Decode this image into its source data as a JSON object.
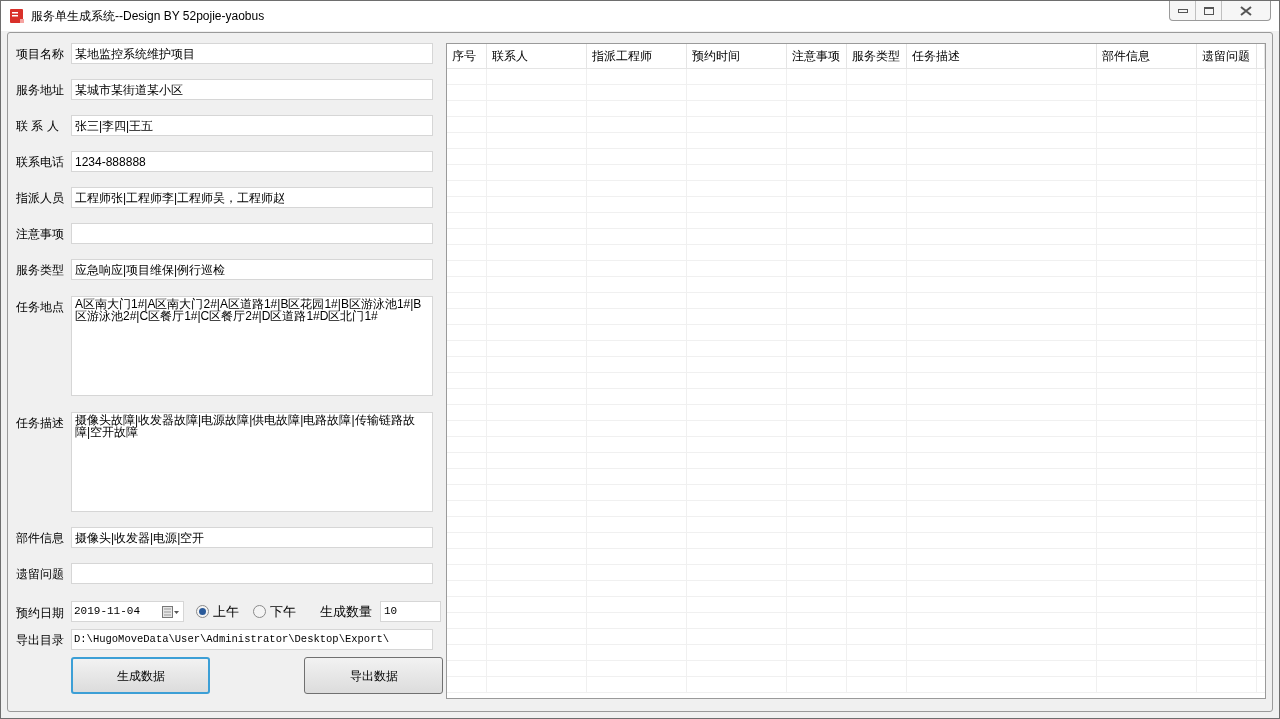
{
  "window": {
    "title": "服务单生成系统--Design BY 52pojie-yaobus"
  },
  "form": {
    "fields": [
      {
        "label": "项目名称",
        "kind": "text",
        "value": "某地监控系统维护项目"
      },
      {
        "label": "服务地址",
        "kind": "text",
        "value": "某城市某街道某小区"
      },
      {
        "label": "联 系 人",
        "kind": "text",
        "value": "张三|李四|王五"
      },
      {
        "label": "联系电话",
        "kind": "text",
        "value": "1234-888888"
      },
      {
        "label": "指派人员",
        "kind": "text",
        "value": "工程师张|工程师李|工程师吴，工程师赵"
      },
      {
        "label": "注意事项",
        "kind": "text"
      },
      {
        "label": "服务类型",
        "kind": "text",
        "value": "应急响应|项目维保|例行巡检"
      },
      {
        "label": "任务地点",
        "kind": "textarea",
        "value": "A区南大门1#|A区南大门2#|A区道路1#|B区花园1#|B区游泳池1#|B区游泳池2#|C区餐厅1#|C区餐厅2#|D区道路1#D区北门1#"
      },
      {
        "label": "任务描述",
        "kind": "textarea",
        "value": "摄像头故障|收发器故障|电源故障|供电故障|电路故障|传输链路故障|空开故障"
      },
      {
        "label": "部件信息",
        "kind": "text",
        "value": "摄像头|收发器|电源|空开"
      },
      {
        "label": "遗留问题",
        "kind": "text"
      }
    ],
    "date": {
      "label": "预约日期",
      "value": "2019-11-04"
    },
    "period": [
      {
        "label": "上午",
        "selected": true
      },
      {
        "label": "下午",
        "selected": false
      }
    ],
    "count": {
      "label": "生成数量",
      "value": "10"
    },
    "export_dir": {
      "label": "导出目录",
      "value": "D:\\HugoMoveData\\User\\Administrator\\Desktop\\Export\\"
    },
    "buttons": [
      {
        "label": "生成数据",
        "focused": true
      },
      {
        "label": "导出数据",
        "focused": false
      }
    ]
  },
  "table": {
    "columns": [
      "序号",
      "联系人",
      "指派工程师",
      "预约时间",
      "注意事项",
      "服务类型",
      "任务描述",
      "部件信息",
      "遗留问题"
    ]
  }
}
